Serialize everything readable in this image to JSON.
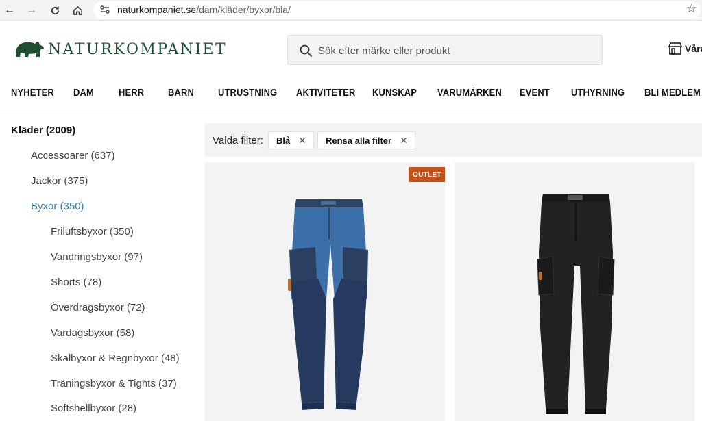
{
  "browser": {
    "url_host": "naturkompaniet.se",
    "url_path": "/dam/kläder/byxor/bla/"
  },
  "header": {
    "logo_text": "NATURKOMPANIET",
    "search_placeholder": "Sök efter märke eller produkt",
    "stores_label": "Våra"
  },
  "nav": {
    "items": [
      "NYHETER",
      "DAM",
      "HERR",
      "BARN",
      "UTRUSTNING",
      "AKTIVITETER",
      "KUNSKAP",
      "VARUMÄRKEN",
      "EVENT",
      "UTHYRNING",
      "BLI MEDLEM"
    ]
  },
  "sidebar": {
    "title": "Kläder (2009)",
    "items": [
      {
        "label": "Accessoarer (637)",
        "level": 1
      },
      {
        "label": "Jackor (375)",
        "level": 1
      },
      {
        "label": "Byxor (350)",
        "level": 1,
        "active": true
      },
      {
        "label": "Friluftsbyxor (350)",
        "level": 2
      },
      {
        "label": "Vandringsbyxor (97)",
        "level": 2
      },
      {
        "label": "Shorts (78)",
        "level": 2
      },
      {
        "label": "Överdragsbyxor (72)",
        "level": 2
      },
      {
        "label": "Vardagsbyxor (58)",
        "level": 2
      },
      {
        "label": "Skalbyxor & Regnbyxor (48)",
        "level": 2
      },
      {
        "label": "Träningsbyxor & Tights (37)",
        "level": 2
      },
      {
        "label": "Softshellbyxor (28)",
        "level": 2
      }
    ],
    "active_color": "#2b7ea1"
  },
  "filters": {
    "label": "Valda filter:",
    "chips": [
      "Blå",
      "Rensa alla filter"
    ]
  },
  "products": [
    {
      "badge": "OUTLET",
      "image": "blue-trousers-icon",
      "badge_color": "#c0531c"
    },
    {
      "badge": "",
      "image": "black-trousers-icon"
    }
  ],
  "colors": {
    "brand_green": "#1e4f33",
    "accent_blue": "#2b7ea1",
    "outlet_orange": "#c0531c"
  }
}
